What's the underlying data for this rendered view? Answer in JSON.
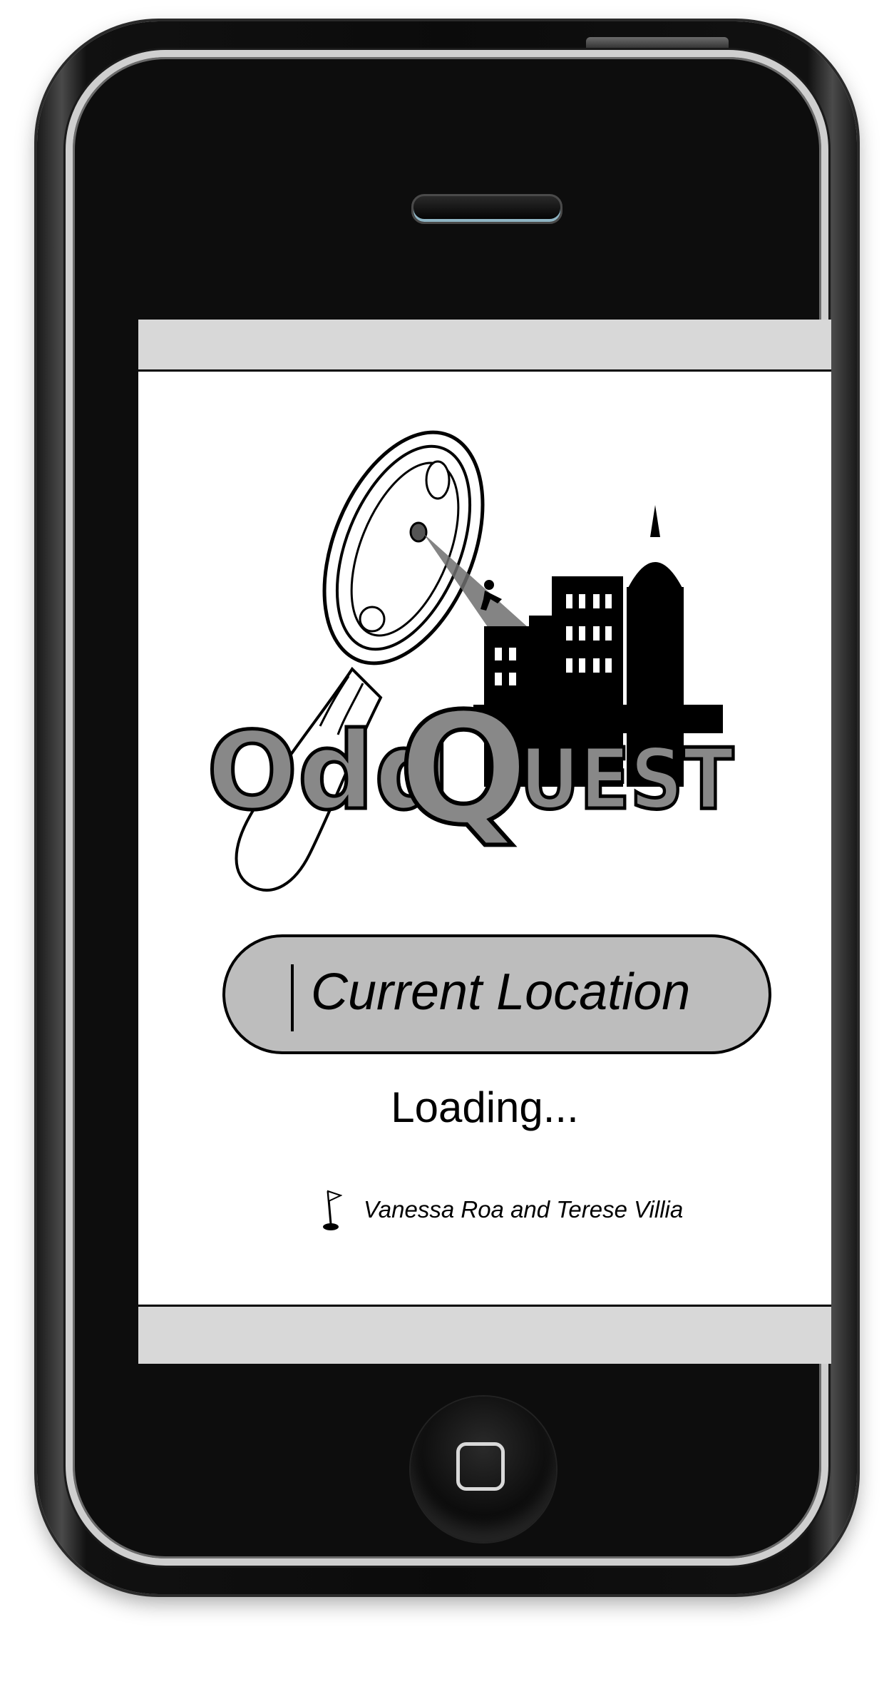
{
  "app": {
    "title_part1": "Odd",
    "title_part2": "Q",
    "title_part3": "UEST"
  },
  "location_field": {
    "value": "Current Location"
  },
  "status": {
    "loading_text": "Loading..."
  },
  "credits": {
    "text": "Vanessa Roa and Terese Villia"
  },
  "icons": {
    "logo": "magnifying-glass-city-logo",
    "credits": "golf-flag-icon",
    "home": "home-button-icon"
  },
  "colors": {
    "logo_text_fill": "#888888",
    "field_fill": "#bdbdbd",
    "bar_fill": "#d8d8d8"
  }
}
